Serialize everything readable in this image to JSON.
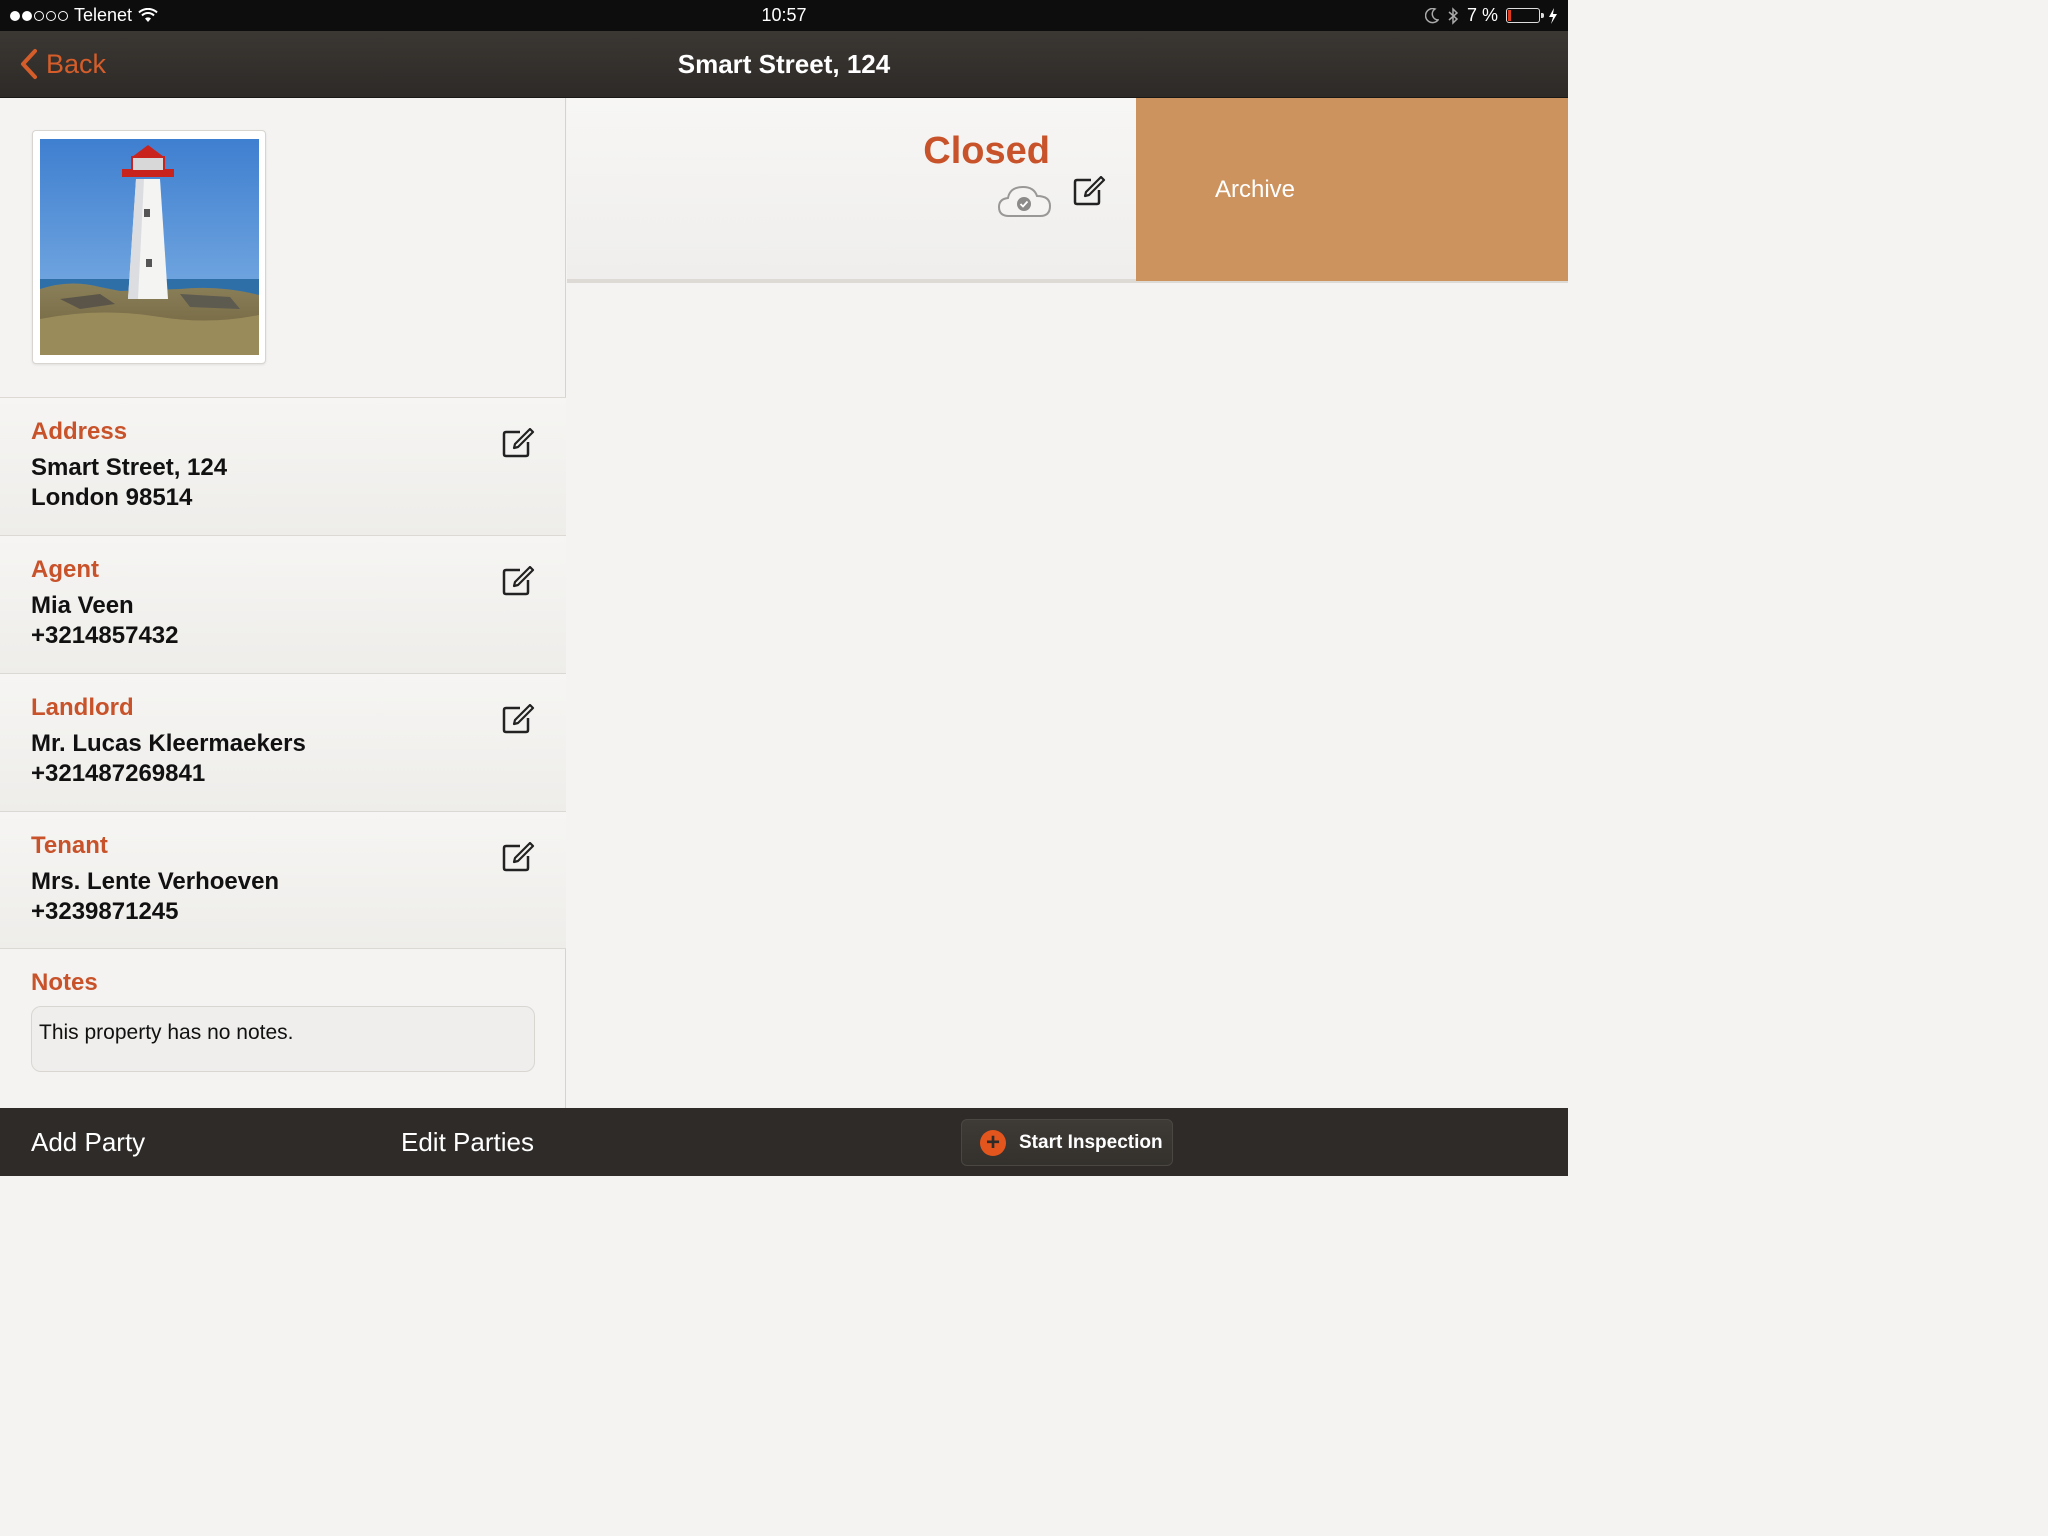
{
  "status_bar": {
    "carrier": "Telenet",
    "time": "10:57",
    "battery": "7 %",
    "signal_dots_filled": 2,
    "signal_dots_total": 5
  },
  "nav": {
    "back_label": "Back",
    "title": "Smart Street, 124"
  },
  "details": {
    "address": {
      "label": "Address",
      "line1": "Smart Street, 124",
      "line2": "London 98514"
    },
    "agent": {
      "label": "Agent",
      "line1": "Mia Veen",
      "line2": "+3214857432"
    },
    "landlord": {
      "label": "Landlord",
      "line1": "Mr. Lucas Kleermaekers",
      "line2": "+321487269841"
    },
    "tenant": {
      "label": "Tenant",
      "line1": "Mrs. Lente Verhoeven",
      "line2": "+3239871245"
    },
    "notes": {
      "label": "Notes",
      "text": "This property has no notes."
    }
  },
  "status": {
    "text": "Closed",
    "archive_label": "Archive"
  },
  "toolbar": {
    "add_party": "Add Party",
    "edit_parties": "Edit Parties",
    "start_inspection": "Start Inspection"
  },
  "colors": {
    "accent": "#c8532a",
    "archive_bg": "#cd935e",
    "toolbar_bg": "#2e2b28",
    "start_plus": "#e2551d"
  },
  "icons": {
    "edit": "edit-icon",
    "cloud": "cloud-sync-icon",
    "back": "chevron-left-icon",
    "wifi": "wifi-icon",
    "bluetooth": "bluetooth-icon",
    "moon": "moon-icon"
  }
}
